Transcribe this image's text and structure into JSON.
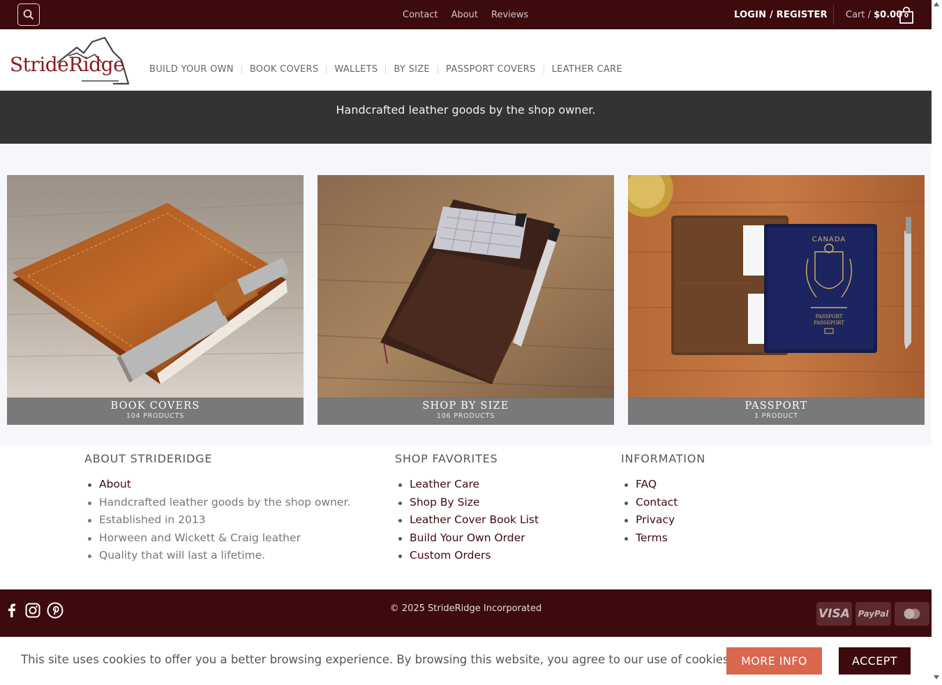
{
  "topbar": {
    "links": [
      "Contact",
      "About",
      "Reviews"
    ],
    "login_label": "LOGIN / REGISTER",
    "cart_prefix": "Cart /",
    "cart_total": "$0.00",
    "cart_count": "0"
  },
  "header": {
    "logo_text": "StrideRidge",
    "nav": [
      "BUILD YOUR OWN",
      "BOOK COVERS",
      "WALLETS",
      "BY SIZE",
      "PASSPORT COVERS",
      "LEATHER CARE"
    ]
  },
  "band": {
    "text": "Handcrafted leather goods by the shop owner."
  },
  "categories": [
    {
      "title": "BOOK COVERS",
      "count": "104 PRODUCTS"
    },
    {
      "title": "SHOP BY SIZE",
      "count": "106 PRODUCTS"
    },
    {
      "title": "PASSPORT",
      "count": "1 PRODUCT"
    }
  ],
  "passport_print": {
    "country": "CANADA",
    "line1": "PASSPORT",
    "line2": "PASSEPORT"
  },
  "footer": {
    "about": {
      "heading": "ABOUT STRIDERIDGE",
      "items": [
        "About",
        "Handcrafted leather goods by the shop owner.",
        "Established in 2013",
        "Horween and Wickett & Craig leather",
        "Quality that will last a lifetime."
      ]
    },
    "favorites": {
      "heading": "SHOP FAVORITES",
      "items": [
        "Leather Care",
        "Shop By Size",
        "Leather Cover Book List",
        "Build Your Own Order",
        "Custom Orders"
      ]
    },
    "information": {
      "heading": "INFORMATION",
      "items": [
        "FAQ",
        "Contact",
        "Privacy",
        "Terms"
      ]
    }
  },
  "bottom": {
    "copyright": "© 2025 StrideRidge Incorporated",
    "payments": [
      "VISA",
      "PayPal"
    ]
  },
  "cookie": {
    "text": "This site uses cookies to offer you a better browsing experience. By browsing this website, you agree to our use of cookies.",
    "more_label": "MORE INFO",
    "accept_label": "ACCEPT"
  },
  "colors": {
    "brand": "#3d0a0e",
    "accent": "#d9674e",
    "logo": "#8b1a1f"
  },
  "icons": [
    "search-icon",
    "cart-icon",
    "facebook-icon",
    "instagram-icon",
    "pinterest-icon",
    "mastercard-icon"
  ]
}
